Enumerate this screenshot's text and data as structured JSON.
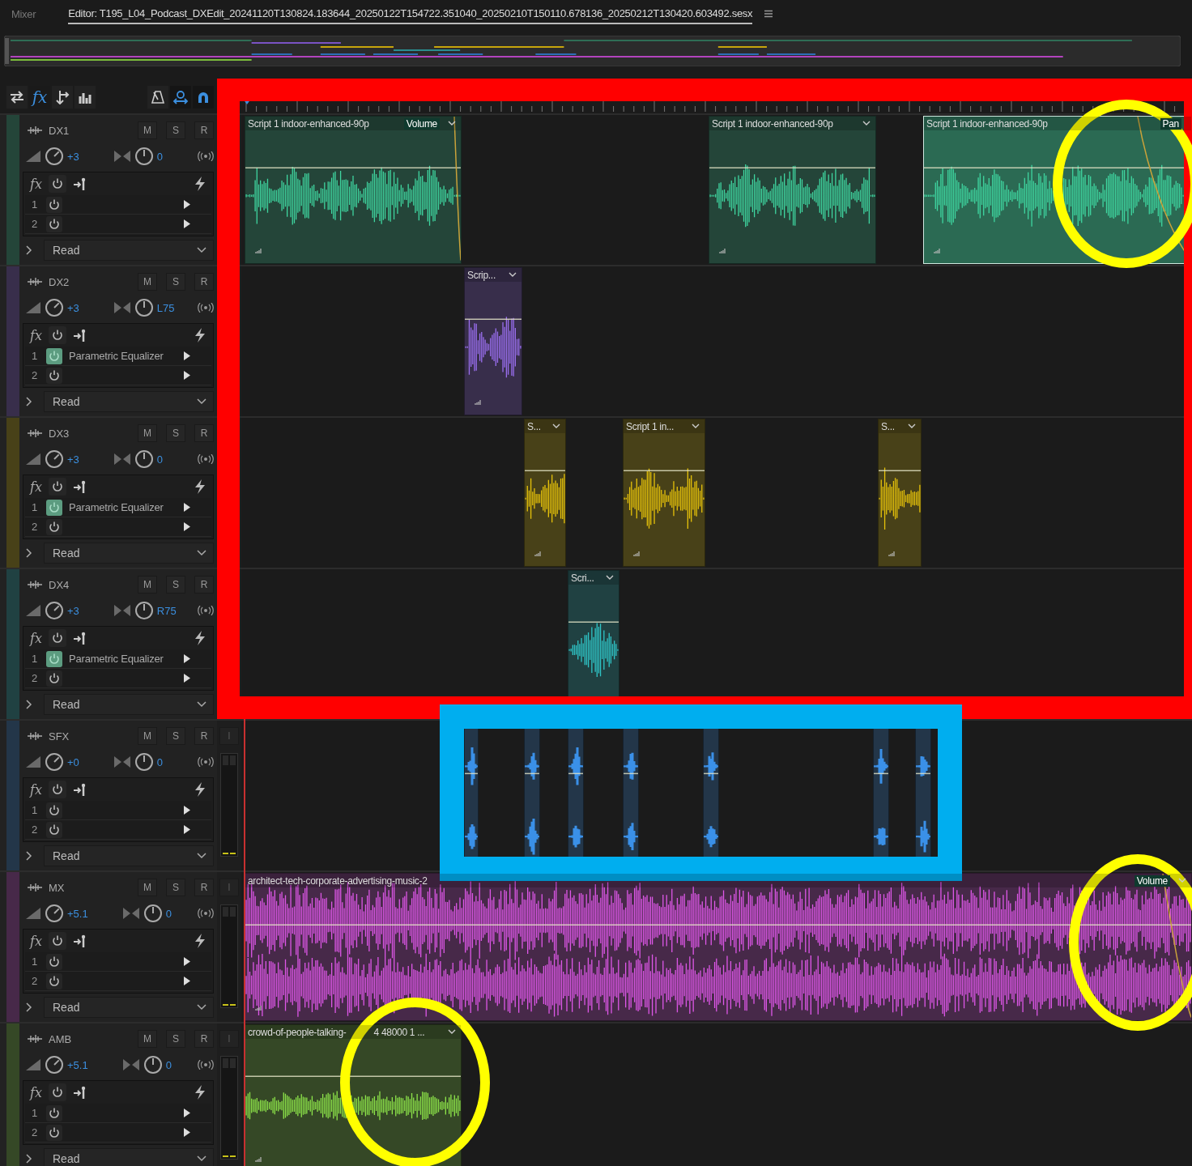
{
  "tabs": [
    {
      "label": "Mixer",
      "selected": false
    },
    {
      "label": "Editor: T195_L04_Podcast_DXEdit_20241120T130824.183644_20250122T154722.351040_20250210T150110.678136_20250212T130420.603492.sesx",
      "selected": true
    }
  ],
  "toolbar": {
    "left": [
      {
        "kind": "swap",
        "selected": false
      },
      {
        "kind": "fx",
        "label": "fx",
        "selected": true
      },
      {
        "kind": "sends",
        "selected": false
      },
      {
        "kind": "eq",
        "selected": false
      }
    ],
    "right": [
      {
        "kind": "metronome",
        "on": false
      },
      {
        "kind": "loop",
        "on": true
      },
      {
        "kind": "snap",
        "on": true
      }
    ]
  },
  "tracks": [
    {
      "name": "DX1",
      "color": "#3fd6a0",
      "buttons": [
        "M",
        "S",
        "R"
      ],
      "volume": {
        "value": "+3"
      },
      "pan": {
        "value": "0"
      },
      "rack_label": "fx",
      "effects": [
        {
          "slot": "1",
          "on": false
        },
        {
          "slot": "2",
          "on": false
        }
      ],
      "automation": "Read",
      "clips": [
        {
          "label": "Script 1 indoor-enhanced-90p",
          "envelope": "Volume",
          "selected": false
        },
        {
          "label": "Script 1 indoor-enhanced-90p",
          "selected": false
        },
        {
          "label": "Script 1 indoor-enhanced-90p",
          "envelope": "Pan",
          "selected": true
        }
      ]
    },
    {
      "name": "DX2",
      "color": "#9b6ff0",
      "buttons": [
        "M",
        "S",
        "R"
      ],
      "volume": {
        "value": "+3"
      },
      "pan": {
        "value": "L75"
      },
      "rack_label": "fx",
      "effects": [
        {
          "slot": "1",
          "name": "Parametric Equalizer",
          "on": true
        },
        {
          "slot": "2",
          "on": false
        }
      ],
      "automation": "Read",
      "clips": [
        {
          "label": "Scrip...",
          "selected": false
        }
      ]
    },
    {
      "name": "DX3",
      "color": "#e6c20a",
      "buttons": [
        "M",
        "S",
        "R"
      ],
      "volume": {
        "value": "+3"
      },
      "pan": {
        "value": "0"
      },
      "rack_label": "fx",
      "effects": [
        {
          "slot": "1",
          "name": "Parametric Equalizer",
          "on": true
        },
        {
          "slot": "2",
          "on": false
        }
      ],
      "automation": "Read",
      "clips": [
        {
          "label": "S...",
          "selected": false
        },
        {
          "label": "Script 1 in...",
          "selected": false
        },
        {
          "label": "S...",
          "selected": false
        }
      ]
    },
    {
      "name": "DX4",
      "color": "#2fc6c8",
      "buttons": [
        "M",
        "S",
        "R"
      ],
      "volume": {
        "value": "+3"
      },
      "pan": {
        "value": "R75"
      },
      "rack_label": "fx",
      "effects": [
        {
          "slot": "1",
          "name": "Parametric Equalizer",
          "on": true
        },
        {
          "slot": "2",
          "on": false
        }
      ],
      "automation": "Read",
      "clips": [
        {
          "label": "Scri...",
          "selected": false
        }
      ]
    },
    {
      "name": "SFX",
      "color": "#3a90e8",
      "buttons": [
        "M",
        "S",
        "R"
      ],
      "volume": {
        "value": "+0"
      },
      "pan": {
        "value": "0"
      },
      "input_button": "I",
      "rack_label": "fx",
      "effects": [
        {
          "slot": "1",
          "on": false
        },
        {
          "slot": "2",
          "on": false
        }
      ],
      "automation": "Read",
      "clips": [
        {
          "selected": false
        },
        {
          "selected": false
        },
        {
          "selected": false
        },
        {
          "selected": false
        },
        {
          "selected": false
        },
        {
          "selected": false
        },
        {
          "selected": false
        }
      ]
    },
    {
      "name": "MX",
      "color": "#de57e8",
      "buttons": [
        "M",
        "S",
        "R"
      ],
      "volume": {
        "value": "+5.1"
      },
      "pan": {
        "value": "0"
      },
      "input_button": "I",
      "rack_label": "fx",
      "effects": [
        {
          "slot": "1",
          "on": false
        },
        {
          "slot": "2",
          "on": false
        }
      ],
      "automation": "Read",
      "clips": [
        {
          "label": "architect-tech-corporate-advertising-music-2",
          "envelope": "Volume",
          "selected": false
        }
      ]
    },
    {
      "name": "AMB",
      "color": "#8ee64a",
      "buttons": [
        "M",
        "S",
        "R"
      ],
      "volume": {
        "value": "+5.1"
      },
      "pan": {
        "value": "0"
      },
      "input_button": "I",
      "rack_label": "fx",
      "effects": [
        {
          "slot": "1",
          "on": false
        },
        {
          "slot": "2",
          "on": false
        }
      ],
      "automation": "Read",
      "clips": [
        {
          "label": "crowd-of-people-talking-",
          "label_end": "4 48000 1 ...",
          "selected": false
        }
      ]
    }
  ]
}
